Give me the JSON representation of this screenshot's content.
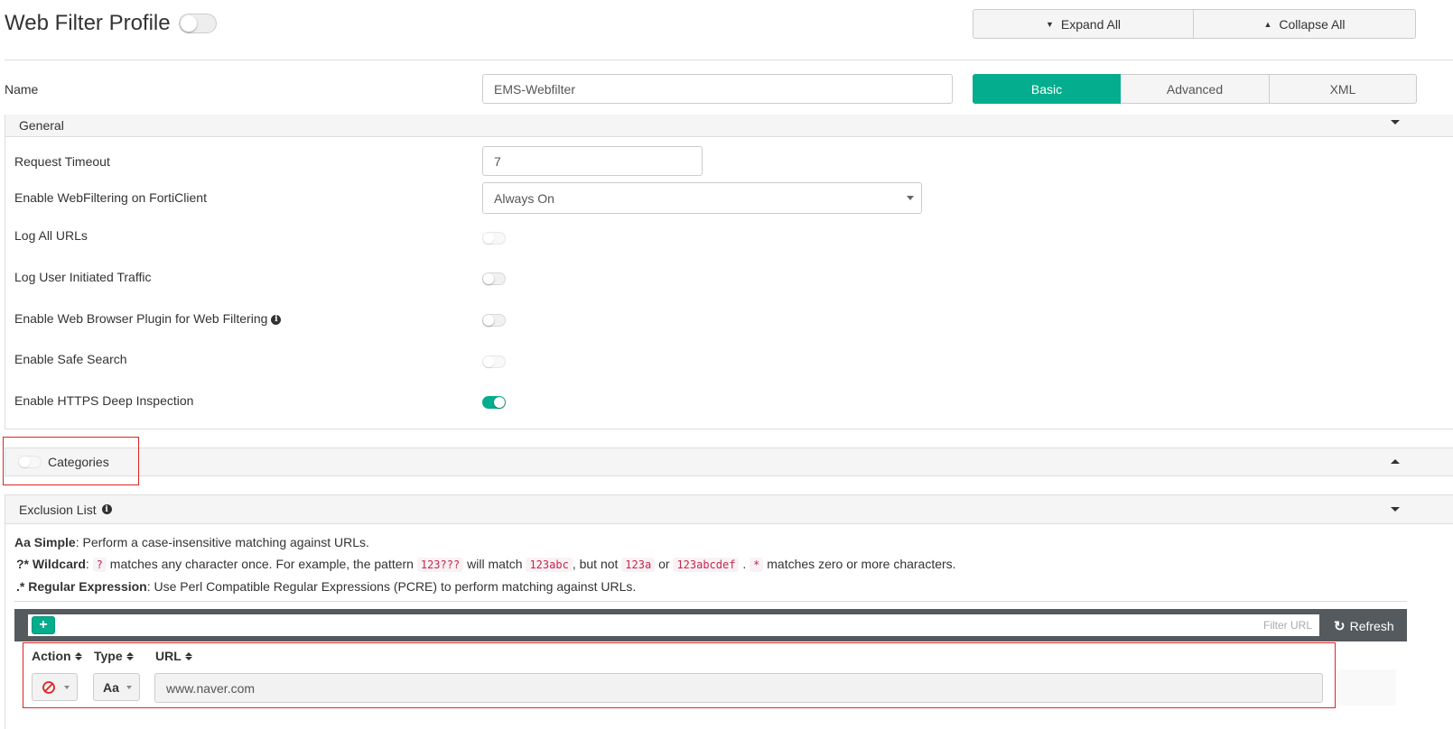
{
  "header": {
    "title": "Web Filter Profile",
    "expand_all": "Expand All",
    "collapse_all": "Collapse All"
  },
  "name_row": {
    "label": "Name",
    "value": "EMS-Webfilter",
    "tabs": [
      {
        "label": "Basic",
        "active": true
      },
      {
        "label": "Advanced",
        "active": false
      },
      {
        "label": "XML",
        "active": false
      }
    ]
  },
  "general": {
    "title": "General",
    "request_timeout_label": "Request Timeout",
    "request_timeout_value": "7",
    "enable_webfiltering_label": "Enable WebFiltering on FortiClient",
    "enable_webfiltering_value": "Always On",
    "log_all_urls_label": "Log All URLs",
    "log_user_traffic_label": "Log User Initiated Traffic",
    "browser_plugin_label": "Enable Web Browser Plugin for Web Filtering",
    "safe_search_label": "Enable Safe Search",
    "https_inspection_label": "Enable HTTPS Deep Inspection"
  },
  "categories": {
    "title": "Categories"
  },
  "exclusion": {
    "title": "Exclusion List",
    "simple_prefix": "Aa Simple",
    "simple_text": ": Perform a case-insensitive matching against URLs.",
    "wildcard_prefix": "?* Wildcard",
    "wildcard_t1": ": ",
    "wildcard_c1": "?",
    "wildcard_t2": " matches any character once. For example, the pattern ",
    "wildcard_c2": "123???",
    "wildcard_t3": " will match ",
    "wildcard_c3": "123abc",
    "wildcard_t4": ", but not ",
    "wildcard_c4": "123a",
    "wildcard_t5": " or ",
    "wildcard_c5": "123abcdef",
    "wildcard_t6": " . ",
    "wildcard_c6": "*",
    "wildcard_t7": " matches zero or more characters.",
    "regex_prefix": ".*  Regular Expression",
    "regex_text": ": Use Perl Compatible Regular Expressions (PCRE) to perform matching against URLs.",
    "add_label": "+",
    "filter_placeholder": "Filter URL",
    "refresh_label": "Refresh",
    "columns": [
      "Action",
      "Type",
      "URL"
    ],
    "rows": [
      {
        "action_icon": "block-icon",
        "type": "Aa",
        "url": "www.naver.com"
      }
    ]
  }
}
